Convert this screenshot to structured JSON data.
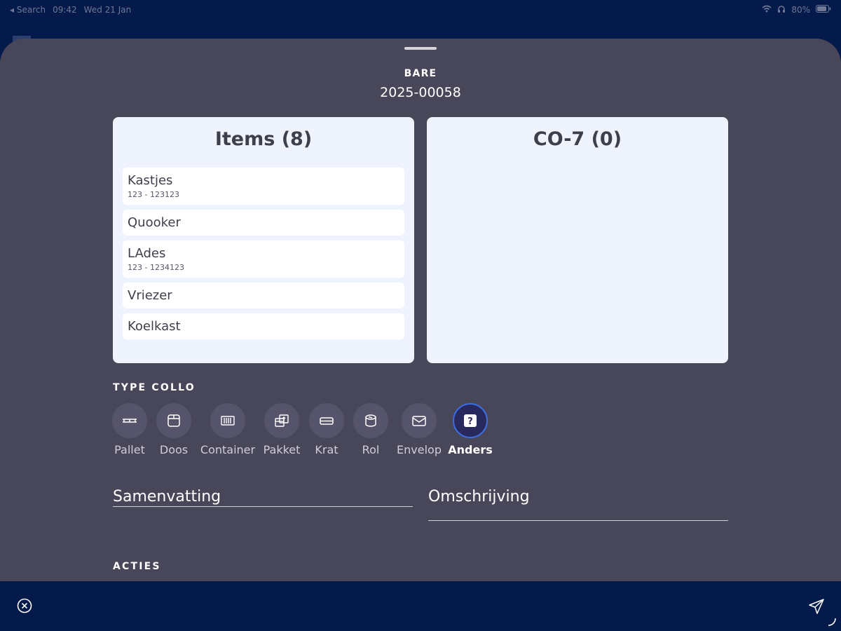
{
  "status_bar": {
    "back_label": "◂ Search",
    "time": "09:42",
    "date": "Wed 21 Jan",
    "battery": "80%"
  },
  "sheet": {
    "label": "BARE",
    "number": "2025-00058"
  },
  "items_panel": {
    "title": "Items (8)",
    "items": [
      {
        "name": "Kastjes",
        "sub": "123 - 123123"
      },
      {
        "name": "Quooker",
        "sub": ""
      },
      {
        "name": "LAdes",
        "sub": "123 - 1234123"
      },
      {
        "name": "Vriezer",
        "sub": ""
      },
      {
        "name": "Koelkast",
        "sub": ""
      }
    ]
  },
  "co_panel": {
    "title": "CO-7 (0)"
  },
  "type_collo": {
    "title": "TYPE COLLO",
    "selected": "Anders",
    "options": [
      {
        "label": "Pallet",
        "icon": "pallet-icon"
      },
      {
        "label": "Doos",
        "icon": "box-icon"
      },
      {
        "label": "Container",
        "icon": "container-icon"
      },
      {
        "label": "Pakket",
        "icon": "package-icon"
      },
      {
        "label": "Krat",
        "icon": "crate-icon"
      },
      {
        "label": "Rol",
        "icon": "roll-icon"
      },
      {
        "label": "Envelop",
        "icon": "envelope-icon"
      },
      {
        "label": "Anders",
        "icon": "question-icon"
      }
    ]
  },
  "fields": {
    "summary_placeholder": "Samenvatting",
    "description_placeholder": "Omschrijving"
  },
  "actions": {
    "title": "ACTIES"
  },
  "colors": {
    "background": "#041a4a",
    "sheet": "#484659",
    "panel": "#eef3fe",
    "selected_ring": "#3b6fe8"
  }
}
